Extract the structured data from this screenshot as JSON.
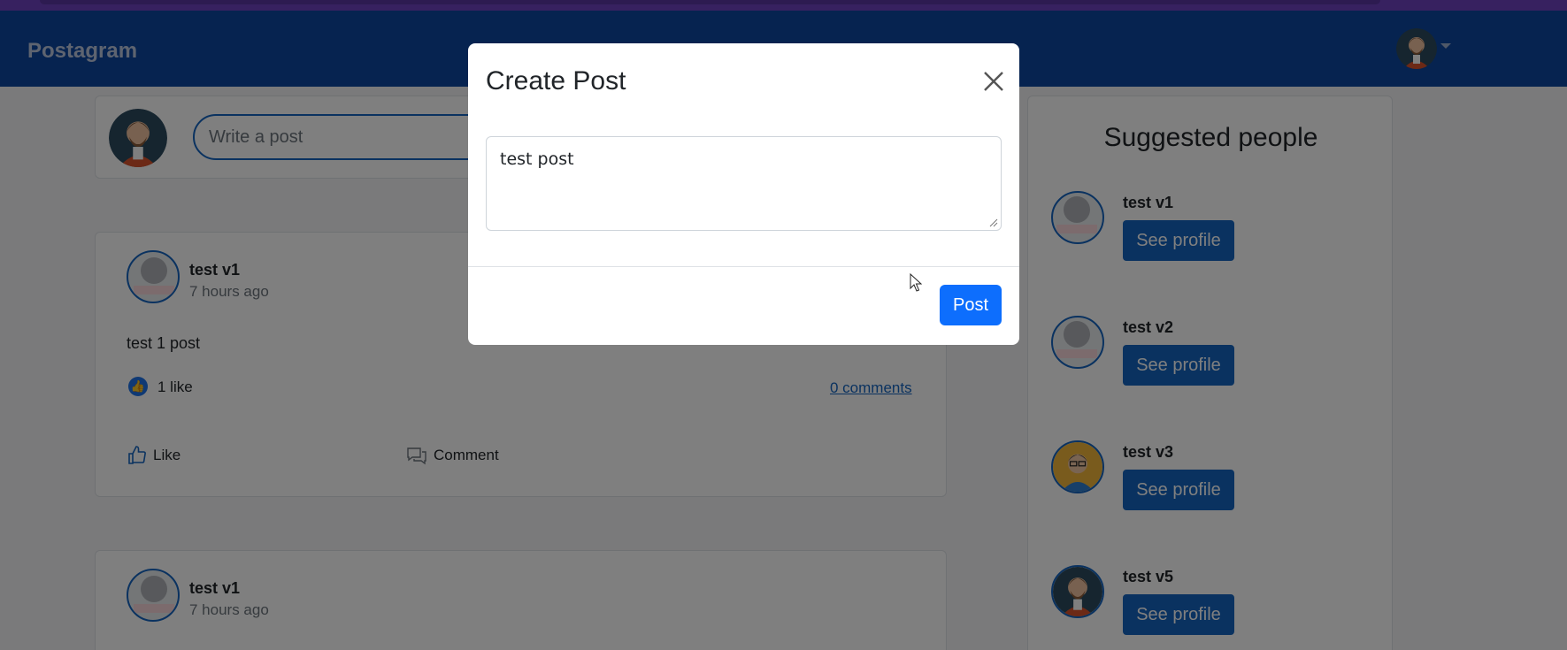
{
  "navbar": {
    "brand": "Postagram"
  },
  "composer": {
    "placeholder": "Write a post"
  },
  "feed": {
    "posts": [
      {
        "author": "test v1",
        "time": "7 hours ago",
        "content": "test 1 post",
        "likes": "1 like",
        "comments": "0 comments",
        "like_label": "Like",
        "comment_label": "Comment"
      },
      {
        "author": "test v1",
        "time": "7 hours ago"
      }
    ]
  },
  "sidebar": {
    "title": "Suggested people",
    "people": [
      {
        "name": "test v1",
        "button": "See profile"
      },
      {
        "name": "test v2",
        "button": "See profile"
      },
      {
        "name": "test v3",
        "button": "See profile"
      },
      {
        "name": "test v5",
        "button": "See profile"
      }
    ]
  },
  "modal": {
    "title": "Create Post",
    "textarea_value": "test post",
    "submit_label": "Post"
  },
  "colors": {
    "navbar": "#0d47a1",
    "primary": "#0d6efd",
    "secondary_button": "#1565c0",
    "backdrop": "rgba(0,0,0,0.5)"
  },
  "icons": [
    "close-icon",
    "thumbs-up-icon",
    "comment-icon",
    "caret-down-icon",
    "mouse-cursor-icon"
  ]
}
